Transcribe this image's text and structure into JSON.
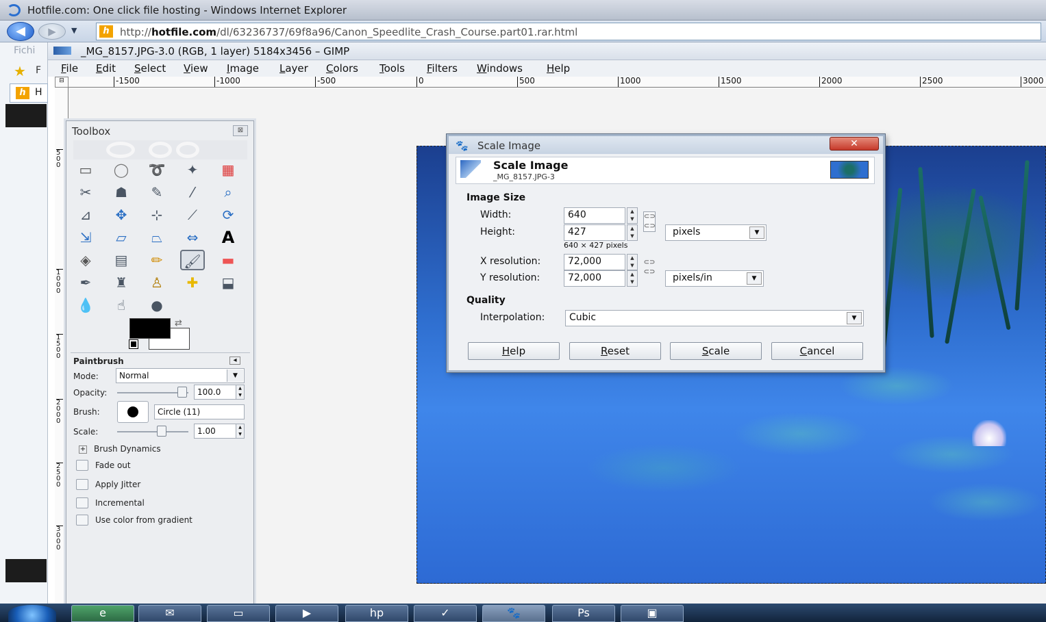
{
  "browser": {
    "title": "Hotfile.com: One click file hosting - Windows Internet Explorer",
    "url_prefix": "http://",
    "url_host": "hotfile.com",
    "url_path": "/dl/63236737/69f8a96/Canon_Speedlite_Crash_Course.part01.rar.html",
    "favicon_letter": "h",
    "left_panel_text": "Fichi",
    "favorites_char": "F",
    "tab_char": "H"
  },
  "gimp": {
    "window_title": "_MG_8157.JPG-3.0 (RGB, 1 layer) 5184x3456 – GIMP",
    "menu": [
      "File",
      "Edit",
      "Select",
      "View",
      "Image",
      "Layer",
      "Colors",
      "Tools",
      "Filters",
      "Windows",
      "Help"
    ],
    "ruler_h_ticks": [
      "-1500",
      "-1000",
      "-500",
      "0",
      "500",
      "1000",
      "1500",
      "2000",
      "2500",
      "3000"
    ],
    "ruler_v_ticks": [
      "500",
      "1000",
      "1500",
      "2000",
      "2500",
      "3000"
    ]
  },
  "toolbox": {
    "title": "Toolbox",
    "tool_icons": [
      "rect-select-icon",
      "ellipse-select-icon",
      "free-select-icon",
      "fuzzy-select-icon",
      "color-select-icon",
      "scissors-icon",
      "foreground-select-icon",
      "paths-icon",
      "color-picker-icon",
      "zoom-icon",
      "measure-icon",
      "move-icon",
      "align-icon",
      "crop-icon",
      "rotate-icon",
      "scale-icon",
      "shear-icon",
      "perspective-icon",
      "flip-icon",
      "text-icon",
      "bucket-fill-icon",
      "blend-icon",
      "pencil-icon",
      "paintbrush-icon",
      "eraser-icon",
      "airbrush-icon",
      "ink-icon",
      "clone-icon",
      "heal-icon",
      "perspective-clone-icon",
      "blur-icon",
      "smudge-icon",
      "dodge-burn-icon"
    ],
    "text_tool_glyph": "A",
    "options": {
      "title": "Paintbrush",
      "mode_label": "Mode:",
      "mode_value": "Normal",
      "opacity_label": "Opacity:",
      "opacity_value": "100.0",
      "brush_label": "Brush:",
      "brush_value": "Circle (11)",
      "scale_label": "Scale:",
      "scale_value": "1.00",
      "dynamics_label": "Brush Dynamics",
      "checkboxes": [
        "Fade out",
        "Apply Jitter",
        "Incremental",
        "Use color from gradient"
      ]
    }
  },
  "dialog": {
    "window_title": "Scale Image",
    "close_glyph": "✕",
    "header_title": "Scale Image",
    "header_subtitle": "_MG_8157.JPG-3",
    "image_size_label": "Image Size",
    "width_label": "Width:",
    "width_value": "640",
    "height_label": "Height:",
    "height_value": "427",
    "size_unit": "pixels",
    "size_summary": "640 × 427 pixels",
    "xres_label": "X resolution:",
    "xres_value": "72,000",
    "yres_label": "Y resolution:",
    "yres_value": "72,000",
    "res_unit": "pixels/in",
    "quality_label": "Quality",
    "interp_label": "Interpolation:",
    "interp_value": "Cubic",
    "buttons": {
      "help": "Help",
      "reset": "Reset",
      "scale": "Scale",
      "cancel": "Cancel"
    }
  },
  "taskbar": {
    "items": [
      "ie-icon",
      "outlook-icon",
      "explorer-icon",
      "media-player-icon",
      "hp-icon",
      "check-icon",
      "gimp-icon",
      "photoshop-icon",
      "powerpoint-icon"
    ],
    "ps_label": "Ps",
    "hp_label": "hp"
  }
}
